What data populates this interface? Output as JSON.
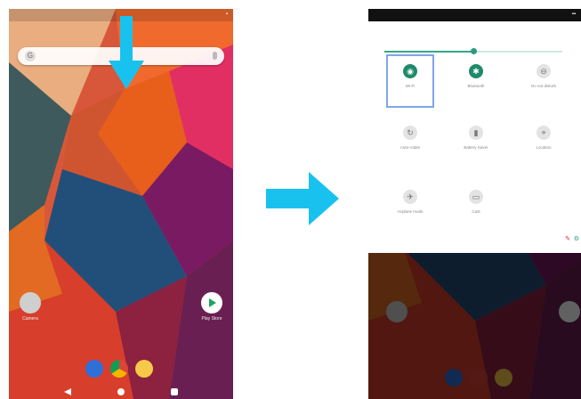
{
  "left_screen": {
    "status": {
      "time": "",
      "icons": "▪"
    },
    "search": {
      "logo": "G"
    },
    "apps": [
      {
        "name": "Camera",
        "icon": "camera-app-icon"
      },
      {
        "name": "Play Store",
        "icon": "play-store-icon"
      }
    ],
    "dock": [
      "messages-icon",
      "chrome-icon",
      "photos-icon"
    ]
  },
  "right_screen": {
    "status": {
      "time": "",
      "icons": "▪▪"
    },
    "brightness_level": 0.5,
    "tiles": [
      {
        "label": "Wi-Fi",
        "icon": "wifi-icon",
        "active": true,
        "selected": true
      },
      {
        "label": "Bluetooth",
        "icon": "bluetooth-icon",
        "active": true,
        "selected": false
      },
      {
        "label": "Do not disturb",
        "icon": "dnd-icon",
        "active": false,
        "selected": false
      },
      {
        "label": "Auto-rotate",
        "icon": "rotate-icon",
        "active": false,
        "selected": false
      },
      {
        "label": "Battery Saver",
        "icon": "battery-icon",
        "active": false,
        "selected": false
      },
      {
        "label": "Location",
        "icon": "location-icon",
        "active": false,
        "selected": false
      },
      {
        "label": "Airplane mode",
        "icon": "airplane-icon",
        "active": false,
        "selected": false
      },
      {
        "label": "Cast",
        "icon": "cast-icon",
        "active": false,
        "selected": false
      }
    ]
  },
  "colors": {
    "arrow": "#19c2ee",
    "accent": "#1f8a6b",
    "selection": "#7fa6ea"
  }
}
